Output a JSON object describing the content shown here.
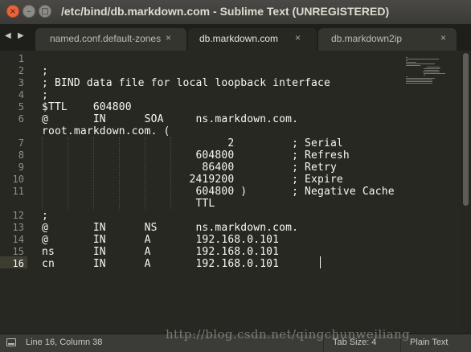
{
  "window": {
    "title": "/etc/bind/db.markdown.com - Sublime Text (UNREGISTERED)",
    "close_symbol": "×",
    "minimize_symbol": "–",
    "maximize_symbol": "□"
  },
  "nav": {
    "left_arrow": "◀",
    "right_arrow": "▶"
  },
  "tabs": [
    {
      "label": "named.conf.default-zones",
      "close": "×",
      "active": false
    },
    {
      "label": "db.markdown.com",
      "close": "×",
      "active": true
    },
    {
      "label": "db.markdown2ip",
      "close": "×",
      "active": false
    }
  ],
  "editor": {
    "current_line": 16,
    "lines": [
      {
        "num": "1",
        "text": ""
      },
      {
        "num": "2",
        "text": ";"
      },
      {
        "num": "3",
        "text": "; BIND data file for local loopback interface"
      },
      {
        "num": "4",
        "text": ";"
      },
      {
        "num": "5",
        "text": "$TTL    604800"
      },
      {
        "num": "6",
        "text": "@       IN      SOA     ns.markdown.com."
      },
      {
        "num": "",
        "text": "root.markdown.com. ("
      },
      {
        "num": "7",
        "text": "                             2         ; Serial"
      },
      {
        "num": "8",
        "text": "                        604800         ; Refresh"
      },
      {
        "num": "9",
        "text": "                         86400         ; Retry"
      },
      {
        "num": "10",
        "text": "                       2419200         ; Expire"
      },
      {
        "num": "11",
        "text": "                        604800 )       ; Negative Cache"
      },
      {
        "num": "",
        "text": "                        TTL"
      },
      {
        "num": "12",
        "text": ";"
      },
      {
        "num": "13",
        "text": "@       IN      NS      ns.markdown.com."
      },
      {
        "num": "14",
        "text": "@       IN      A       192.168.0.101"
      },
      {
        "num": "15",
        "text": "ns      IN      A       192.168.0.101"
      },
      {
        "num": "16",
        "text": "cn      IN      A       192.168.0.101"
      }
    ]
  },
  "status": {
    "position": "Line 16, Column 38",
    "tab_size": "Tab Size: 4",
    "syntax": "Plain Text"
  },
  "watermark": "http://blog.csdn.net/qingchunweiliang",
  "colors": {
    "editor_bg": "#272822",
    "text": "#f8f8f2",
    "gutter_text": "#90908a",
    "close_button": "#e9643a",
    "status_bg": "#3b3b38"
  }
}
